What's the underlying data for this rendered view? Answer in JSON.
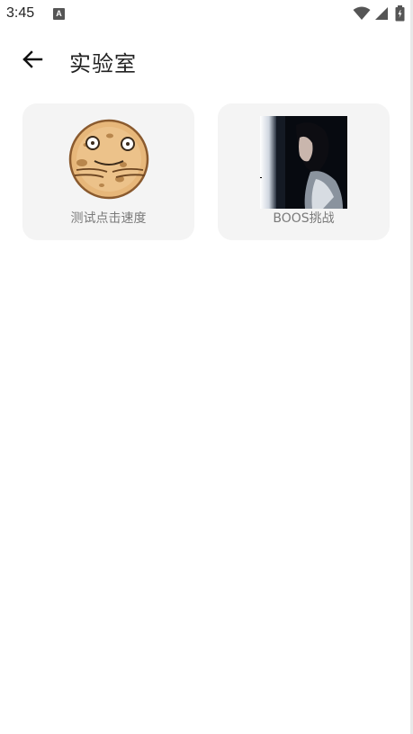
{
  "status_bar": {
    "time": "3:45",
    "notification_icon": "a-notification-icon",
    "notification_letter": "A",
    "icons": [
      "wifi-icon",
      "signal-icon",
      "battery-icon"
    ]
  },
  "header": {
    "back_icon": "arrow-left-icon",
    "title": "实验室"
  },
  "cards": [
    {
      "label": "测试点击速度",
      "image": "cookie-face-image"
    },
    {
      "label": "BOOS挑战",
      "image": "girl-photo-image"
    }
  ],
  "colors": {
    "background": "#ffffff",
    "card_background": "#f4f4f4",
    "label_text": "#7a7a7a",
    "cookie": "#e7b77a",
    "cookie_outline": "#8a5a2e"
  }
}
